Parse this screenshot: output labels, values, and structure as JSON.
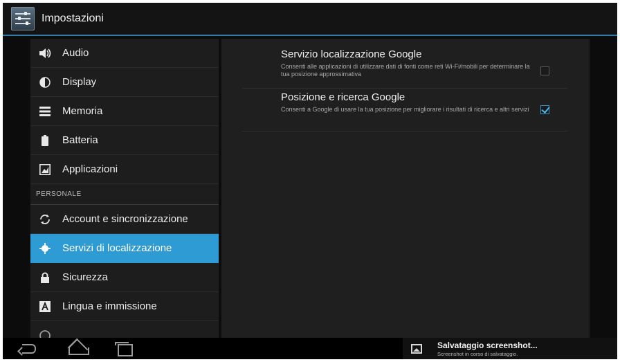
{
  "header": {
    "title": "Impostazioni",
    "app_icon": "settings-app-icon"
  },
  "sidebar": {
    "items": [
      {
        "label": "Audio",
        "icon": "speaker-icon"
      },
      {
        "label": "Display",
        "icon": "brightness-icon"
      },
      {
        "label": "Memoria",
        "icon": "storage-icon"
      },
      {
        "label": "Batteria",
        "icon": "battery-icon"
      },
      {
        "label": "Applicazioni",
        "icon": "apps-icon"
      }
    ],
    "section_label": "PERSONALE",
    "personal_items": [
      {
        "label": "Account e sincronizzazione",
        "icon": "sync-icon"
      },
      {
        "label": "Servizi di localizzazione",
        "icon": "location-icon",
        "selected": true
      },
      {
        "label": "Sicurezza",
        "icon": "lock-icon"
      },
      {
        "label": "Lingua e immissione",
        "icon": "keyboard-icon"
      }
    ]
  },
  "panel": {
    "prefs": [
      {
        "title": "Servizio localizzazione Google",
        "summary": "Consenti alle applicazioni di utilizzare dati di fonti come reti Wi-Fi/mobili per determinare la tua posizione approssimativa",
        "checked": false
      },
      {
        "title": "Posizione e ricerca Google",
        "summary": "Consenti a Google di usare la tua posizione per migliorare i risultati di ricerca e altri servizi",
        "checked": true
      }
    ]
  },
  "notification": {
    "title": "Salvataggio screenshot...",
    "subtitle": "Screenshot in corso di salvataggio.",
    "icon": "image-icon"
  },
  "navbar": {
    "buttons": [
      "back-icon",
      "home-icon",
      "recent-apps-icon"
    ]
  },
  "colors": {
    "accent": "#2e9bd4",
    "background": "#0c0c0c",
    "panel": "#1f1f1f"
  }
}
